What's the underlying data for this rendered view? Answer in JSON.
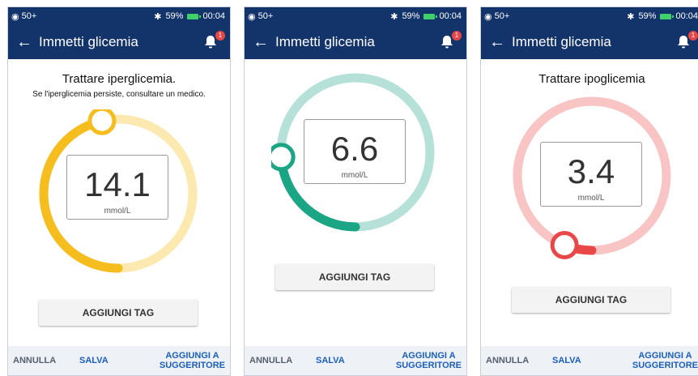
{
  "status": {
    "signal": "50+",
    "battery": "59%",
    "time": "00:04"
  },
  "header": {
    "title": "Immetti glicemia",
    "badge_count": "1"
  },
  "icons": {
    "back": "back-arrow-icon",
    "bell": "bell-icon",
    "bluetooth": "bluetooth-icon",
    "battery": "battery-icon",
    "clock": "alarm-icon"
  },
  "screens": [
    {
      "message_title": "Trattare iperglicemia.",
      "message_sub": "Se l'iperglicemia persiste, consultare un medico.",
      "value": "14.1",
      "unit": "mmol/L",
      "ring_light": "#fbe9b0",
      "ring_dark": "#f5bd1e",
      "level": 0.93
    },
    {
      "message_title": "",
      "message_sub": "",
      "value": "6.6",
      "unit": "mmol/L",
      "ring_light": "#b5e1d8",
      "ring_dark": "#1aa584",
      "level": 0.48
    },
    {
      "message_title": "Trattare ipoglicemia",
      "message_sub": "",
      "value": "3.4",
      "unit": "mmol/L",
      "ring_light": "#f8c4c4",
      "ring_dark": "#e94848",
      "level": 0.12
    }
  ],
  "buttons": {
    "add_tag": "AGGIUNGI TAG",
    "cancel": "ANNULLA",
    "save": "SALVA",
    "add_suggester_line1": "AGGIUNGI A",
    "add_suggester_line2": "SUGGERITORE"
  }
}
